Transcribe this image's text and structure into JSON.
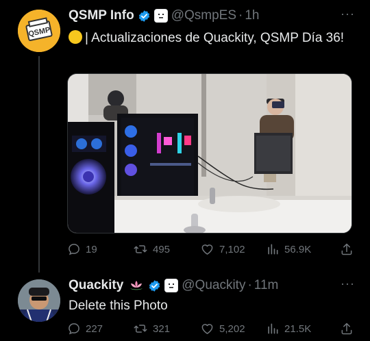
{
  "tweets": [
    {
      "display_name": "QSMP Info",
      "handle": "@QsmpES",
      "time": "1h",
      "avatar_text": "QSMP",
      "text": "| Actualizaciones de Quackity, QSMP Día 36!",
      "stats": {
        "replies": "19",
        "reposts": "495",
        "likes": "7,102",
        "views": "56.9K"
      }
    },
    {
      "display_name": "Quackity",
      "handle": "@Quackity",
      "time": "11m",
      "text": "Delete this Photo",
      "stats": {
        "replies": "227",
        "reposts": "321",
        "likes": "5,202",
        "views": "21.5K"
      }
    }
  ],
  "dot": "·",
  "more": "···",
  "colors": {
    "verified": "#1d9bf0",
    "muted": "#71767b",
    "avatar_bg": "#f5b32a",
    "emoji": "#f7c81e"
  },
  "icons": [
    "verified-icon",
    "blocky-face-badge-icon",
    "lotus-icon",
    "reply-icon",
    "repost-icon",
    "like-icon",
    "views-icon",
    "share-icon",
    "more-icon"
  ]
}
